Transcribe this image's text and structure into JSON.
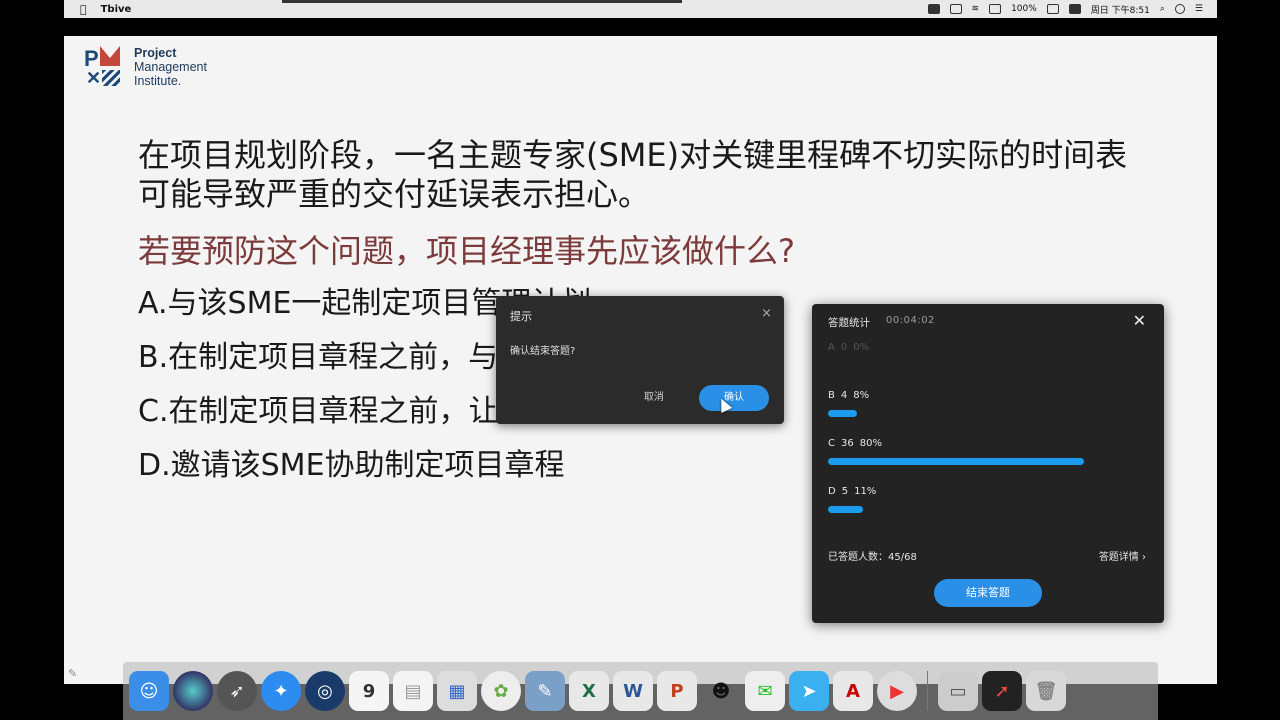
{
  "menubar": {
    "app_name": "Tbive",
    "clock": "周日 下午8:51",
    "battery": "100%"
  },
  "slide": {
    "logo_line1": "Project",
    "logo_line2": "Management",
    "logo_line3": "Institute.",
    "question": "在项目规划阶段，一名主题专家(SME)对关键里程碑不切实际的时间表可能导致严重的交付延误表示担心。",
    "ask": "若要预防这个问题，项目经理事先应该做什么?",
    "options": [
      "A.与该SME一起制定项目管理计划",
      "B.在制定项目章程之前，与该SME讨论",
      "C.在制定项目章程之前，让该SME参与",
      "D.邀请该SME协助制定项目章程"
    ]
  },
  "dialog": {
    "title": "提示",
    "close_icon": "×",
    "message": "确认结束答题?",
    "cancel": "取消",
    "confirm": "确认"
  },
  "stats": {
    "title": "答题统计",
    "timer": "00:04:02",
    "close_icon": "✕",
    "rows": [
      {
        "option": "A",
        "count": "0",
        "percent": "0%",
        "fraction": 0
      },
      {
        "option": "B",
        "count": "4",
        "percent": "8%",
        "fraction": 0.09
      },
      {
        "option": "C",
        "count": "36",
        "percent": "80%",
        "fraction": 0.8
      },
      {
        "option": "D",
        "count": "5",
        "percent": "11%",
        "fraction": 0.11
      }
    ],
    "answered_label": "已答题人数：45/68",
    "details": "答题详情 ›",
    "end_button": "结束答题"
  },
  "dock": {
    "icons": [
      "finder-icon",
      "siri-icon",
      "launchpad-icon",
      "safari-icon",
      "quicktime-icon",
      "calendar-icon",
      "notes-icon",
      "preview-icon",
      "photos-icon",
      "app-icon",
      "excel-icon",
      "word-icon",
      "powerpoint-icon",
      "qq-icon",
      "wechat-icon",
      "feishu-icon",
      "acrobat-icon",
      "video-icon",
      "screenshot-icon",
      "terminal-icon",
      "trash-icon"
    ],
    "calendar_day": "9"
  },
  "colors": {
    "accent_blue": "#2a8fe6",
    "bar_blue": "#1e9cf0",
    "ask_red": "#7c3b3b"
  }
}
